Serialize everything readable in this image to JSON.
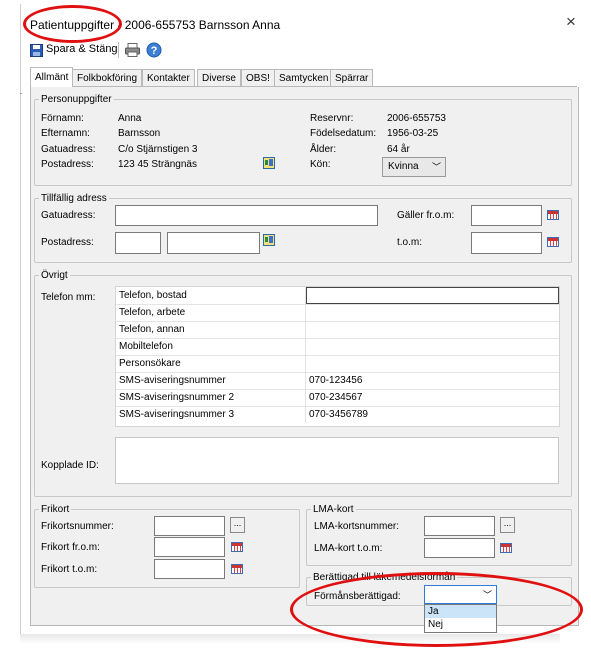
{
  "window": {
    "title_prefix": "Patientuppgifter",
    "title_suffix": "- 2006-655753 Barnsson Anna",
    "close_glyph": "×"
  },
  "toolbar": {
    "save_close_label": "Spara & Stäng"
  },
  "tabs": [
    {
      "label": "Allmänt",
      "active": true
    },
    {
      "label": "Folkbokföring",
      "active": false
    },
    {
      "label": "Kontakter",
      "active": false
    },
    {
      "label": "Diverse",
      "active": false
    },
    {
      "label": "OBS!",
      "active": false
    },
    {
      "label": "Samtycken",
      "active": false
    },
    {
      "label": "Spärrar",
      "active": false
    }
  ],
  "personal": {
    "legend": "Personuppgifter",
    "fornamn_label": "Förnamn:",
    "fornamn_value": "Anna",
    "efternamn_label": "Efternamn:",
    "efternamn_value": "Barnsson",
    "gatuadress_label": "Gatuadress:",
    "gatuadress_value": "C/o Stjärnstigen 3",
    "postadress_label": "Postadress:",
    "postadress_value": "123 45  Strängnäs",
    "reservnr_label": "Reservnr:",
    "reservnr_value": "2006-655753",
    "fodelsedatum_label": "Födelsedatum:",
    "fodelsedatum_value": "1956-03-25",
    "alder_label": "Ålder:",
    "alder_value": "64 år",
    "kon_label": "Kön:",
    "kon_value": "Kvinna"
  },
  "temp_address": {
    "legend": "Tillfällig adress",
    "gatuadress_label": "Gatuadress:",
    "postadress_label": "Postadress:",
    "galler_from_label": "Gäller fr.o.m:",
    "tom_label": "t.o.m:"
  },
  "other": {
    "legend": "Övrigt",
    "telefon_label": "Telefon mm:",
    "phone_rows": [
      {
        "label": "Telefon, bostad",
        "value": ""
      },
      {
        "label": "Telefon, arbete",
        "value": ""
      },
      {
        "label": "Telefon, annan",
        "value": ""
      },
      {
        "label": "Mobiltelefon",
        "value": ""
      },
      {
        "label": "Personsökare",
        "value": ""
      },
      {
        "label": "SMS-aviseringsnummer",
        "value": "070-123456"
      },
      {
        "label": "SMS-aviseringsnummer 2",
        "value": "070-234567"
      },
      {
        "label": "SMS-aviseringsnummer 3",
        "value": "070-3456789"
      }
    ],
    "kopplade_label": "Kopplade ID:"
  },
  "frikort": {
    "legend": "Frikort",
    "nummer_label": "Frikortsnummer:",
    "from_label": "Frikort fr.o.m:",
    "tom_label": "Frikort t.o.m:",
    "ellipsis": "..."
  },
  "lma": {
    "legend": "LMA-kort",
    "nummer_label": "LMA-kortsnummer:",
    "tom_label": "LMA-kort t.o.m:",
    "ellipsis": "..."
  },
  "formansberattigad": {
    "legend": "Berättigad till läkemedelsförmån",
    "label": "Förmånsberättigad:",
    "selected_value": "",
    "options": [
      "Ja",
      "Nej"
    ]
  },
  "colors": {
    "annotation": "#e01010",
    "dropdown_border": "#2f7bd6",
    "option_highlight": "#cce4f7"
  }
}
